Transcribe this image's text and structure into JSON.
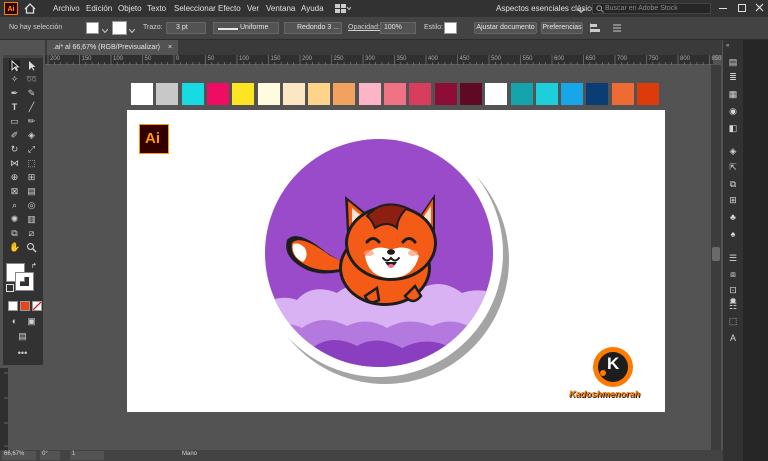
{
  "menu": {
    "logo": "Ai",
    "items": [
      "Archivo",
      "Edición",
      "Objeto",
      "Texto",
      "Seleccionar",
      "Efecto",
      "Ver",
      "Ventana",
      "Ayuda"
    ],
    "workspace": "Aspectos esenciales clásicos",
    "search_placeholder": "Buscar en Adobe Stock"
  },
  "control": {
    "selection": "No hay selección",
    "stroke_label": "Trazo:",
    "stroke_weight": "3 pt",
    "profile": "Uniforme",
    "brush": "Redondo 3 ...",
    "opacity_label": "Opacidad:",
    "opacity": "100%",
    "style_label": "Estilo:",
    "document_setup": "Ajustar documento",
    "preferences": "Preferencias"
  },
  "tab": {
    "label": ".ai* al 66,67% (RGB/Previsualizar)",
    "close": "×"
  },
  "ruler": {
    "marks": [
      "200",
      "150",
      "100",
      "50",
      "0",
      "50",
      "100",
      "150",
      "200",
      "250",
      "300",
      "350",
      "400",
      "450",
      "500",
      "550",
      "600",
      "650",
      "700",
      "750",
      "800",
      "850"
    ]
  },
  "swatches": [
    "#ffffff",
    "#c8c8c8",
    "#16dbe3",
    "#ee0d63",
    "#fde523",
    "#fffbe0",
    "#fde6c4",
    "#fdd489",
    "#f0a25e",
    "#fbb5c6",
    "#ef7384",
    "#d83d5e",
    "#8c0d36",
    "#5e0a25",
    "#ffffff",
    "#16a4ac",
    "#1ccfdb",
    "#17a7e9",
    "#0a3d73",
    "#ef6b34",
    "#dd3c0a"
  ],
  "artwork": {
    "ai_badge": "Ai",
    "brand_letter": "K",
    "brand_name": "Kadoshmenorah",
    "circle_color": "#9a4bc9",
    "cloud_light": "#d8b2f2",
    "fox_color": "#f35b17"
  },
  "status": {
    "zoom": "66,67%",
    "angle": "0°",
    "page": "1",
    "tool": "Mano"
  }
}
